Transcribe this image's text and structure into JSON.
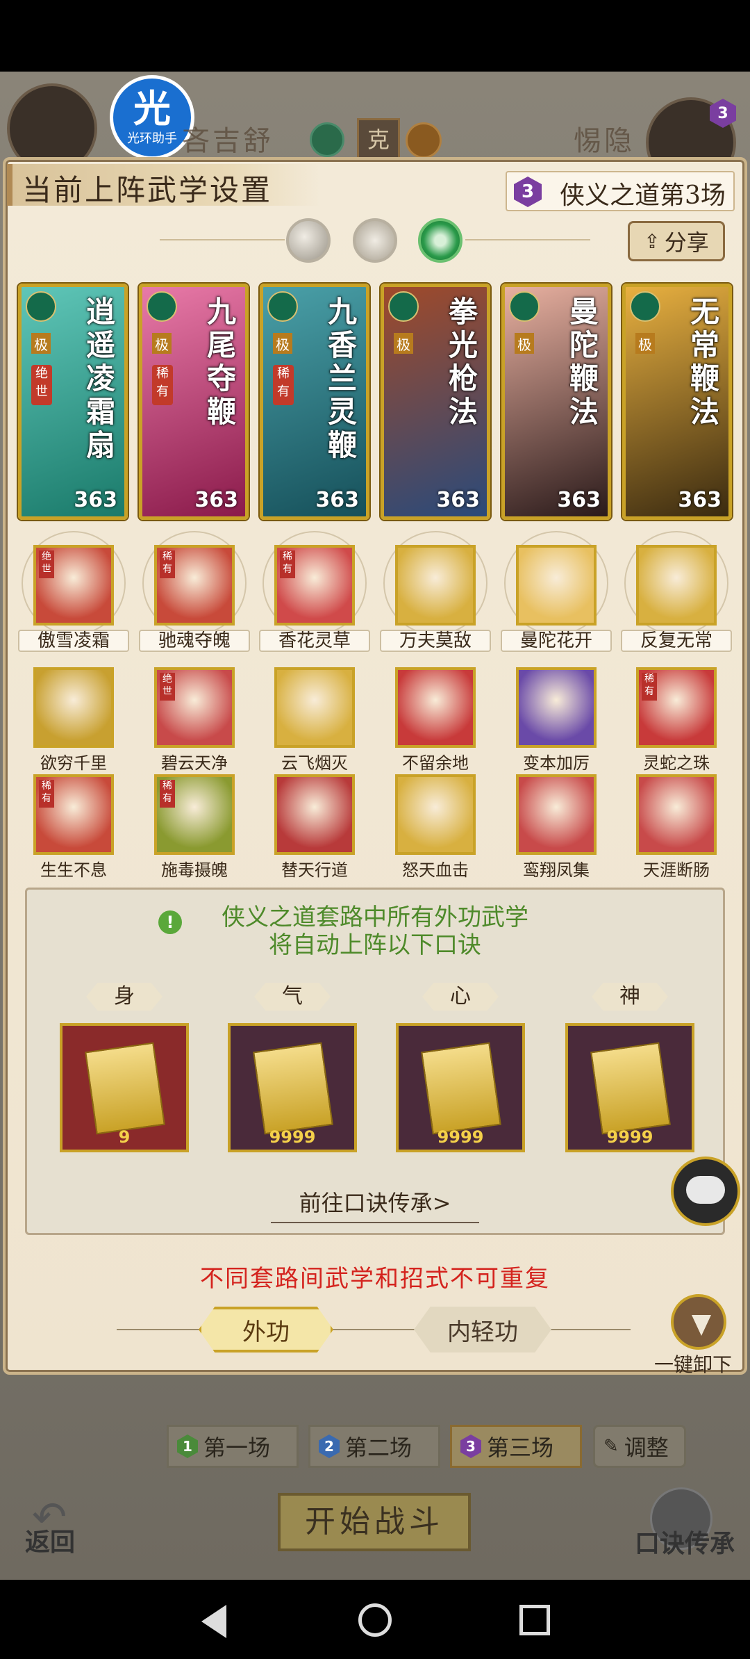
{
  "app": {
    "helper_badge": "光",
    "helper_name": "光环助手"
  },
  "top_bar": {
    "player_left": "吝吉舒",
    "vs_icon": "克",
    "player_right": "惕隐",
    "right_badge": "3"
  },
  "panel": {
    "title": "当前上阵武学设置",
    "scene_num": "3",
    "scene_label": "侠义之道第3场",
    "share_label": "分享"
  },
  "cards": [
    {
      "name": "逍遥凌霜扇",
      "grade": "极",
      "tier": "绝世",
      "level": "363",
      "colors": [
        "#1a7a6a",
        "#5fc6b8"
      ]
    },
    {
      "name": "九尾夺鞭",
      "grade": "极",
      "tier": "稀有",
      "level": "363",
      "colors": [
        "#8a1a4a",
        "#e87aa8"
      ]
    },
    {
      "name": "九香兰灵鞭",
      "grade": "极",
      "tier": "稀有",
      "level": "363",
      "colors": [
        "#16505a",
        "#4aa0a8"
      ]
    },
    {
      "name": "拳光枪法",
      "grade": "极",
      "tier": "",
      "level": "363",
      "colors": [
        "#2a4a7a",
        "#a04a2a"
      ]
    },
    {
      "name": "曼陀鞭法",
      "grade": "极",
      "tier": "",
      "level": "363",
      "colors": [
        "#2a1a1a",
        "#e8b0a0"
      ]
    },
    {
      "name": "无常鞭法",
      "grade": "极",
      "tier": "",
      "level": "363",
      "colors": [
        "#3a2a10",
        "#e8b040"
      ]
    }
  ],
  "skills_row1": [
    {
      "label": "傲雪凌霜",
      "tag": "绝世",
      "color": "#c84a3a"
    },
    {
      "label": "驰魂夺魄",
      "tag": "稀有",
      "color": "#c84a3a"
    },
    {
      "label": "香花灵草",
      "tag": "稀有",
      "color": "#d04a4a"
    },
    {
      "label": "万夫莫敌",
      "tag": "",
      "color": "#d8b040"
    },
    {
      "label": "曼陀花开",
      "tag": "",
      "color": "#e8c060"
    },
    {
      "label": "反复无常",
      "tag": "",
      "color": "#d8b040"
    }
  ],
  "skills_row2": [
    {
      "label": "欲穷千里",
      "tag": "",
      "color": "#c8a030"
    },
    {
      "label": "碧云天净",
      "tag": "绝世",
      "color": "#c84a4a"
    },
    {
      "label": "云飞烟灭",
      "tag": "",
      "color": "#d8b040"
    },
    {
      "label": "不留余地",
      "tag": "",
      "color": "#c83a3a"
    },
    {
      "label": "变本加厉",
      "tag": "",
      "color": "#6a4aa8"
    },
    {
      "label": "灵蛇之珠",
      "tag": "稀有",
      "color": "#c83a3a"
    }
  ],
  "skills_row3": [
    {
      "label": "生生不息",
      "tag": "稀有",
      "color": "#c84a3a"
    },
    {
      "label": "施毒摄魄",
      "tag": "稀有",
      "color": "#8a9a30"
    },
    {
      "label": "替天行道",
      "tag": "",
      "color": "#b83a3a"
    },
    {
      "label": "怒天血击",
      "tag": "",
      "color": "#d8b040"
    },
    {
      "label": "鸾翔凤集",
      "tag": "",
      "color": "#c84a4a"
    },
    {
      "label": "天涯断肠",
      "tag": "",
      "color": "#c84a4a"
    }
  ],
  "info": {
    "line1": "侠义之道套路中所有外功武学",
    "line2": "将自动上阵以下口诀",
    "runes": [
      {
        "tag": "身",
        "count": "9",
        "color": "#8a2a2a"
      },
      {
        "tag": "气",
        "count": "9999",
        "color": "#4a2a3a"
      },
      {
        "tag": "心",
        "count": "9999",
        "color": "#4a2a3a"
      },
      {
        "tag": "神",
        "count": "9999",
        "color": "#4a2a3a"
      }
    ],
    "link": "前往口诀传承>"
  },
  "warning": "不同套路间武学和招式不可重复",
  "tabs": {
    "outer": "外功",
    "inner": "内轻功"
  },
  "unload": "一键卸下",
  "rounds": [
    {
      "num": "1",
      "label": "第一场",
      "color": "#4a8a3a"
    },
    {
      "num": "2",
      "label": "第二场",
      "color": "#3a6ab0"
    },
    {
      "num": "3",
      "label": "第三场",
      "color": "#7a3ea0"
    }
  ],
  "adjust": "调整",
  "start": "开始战斗",
  "back": "返回",
  "rune_inherit": "口诀传承"
}
